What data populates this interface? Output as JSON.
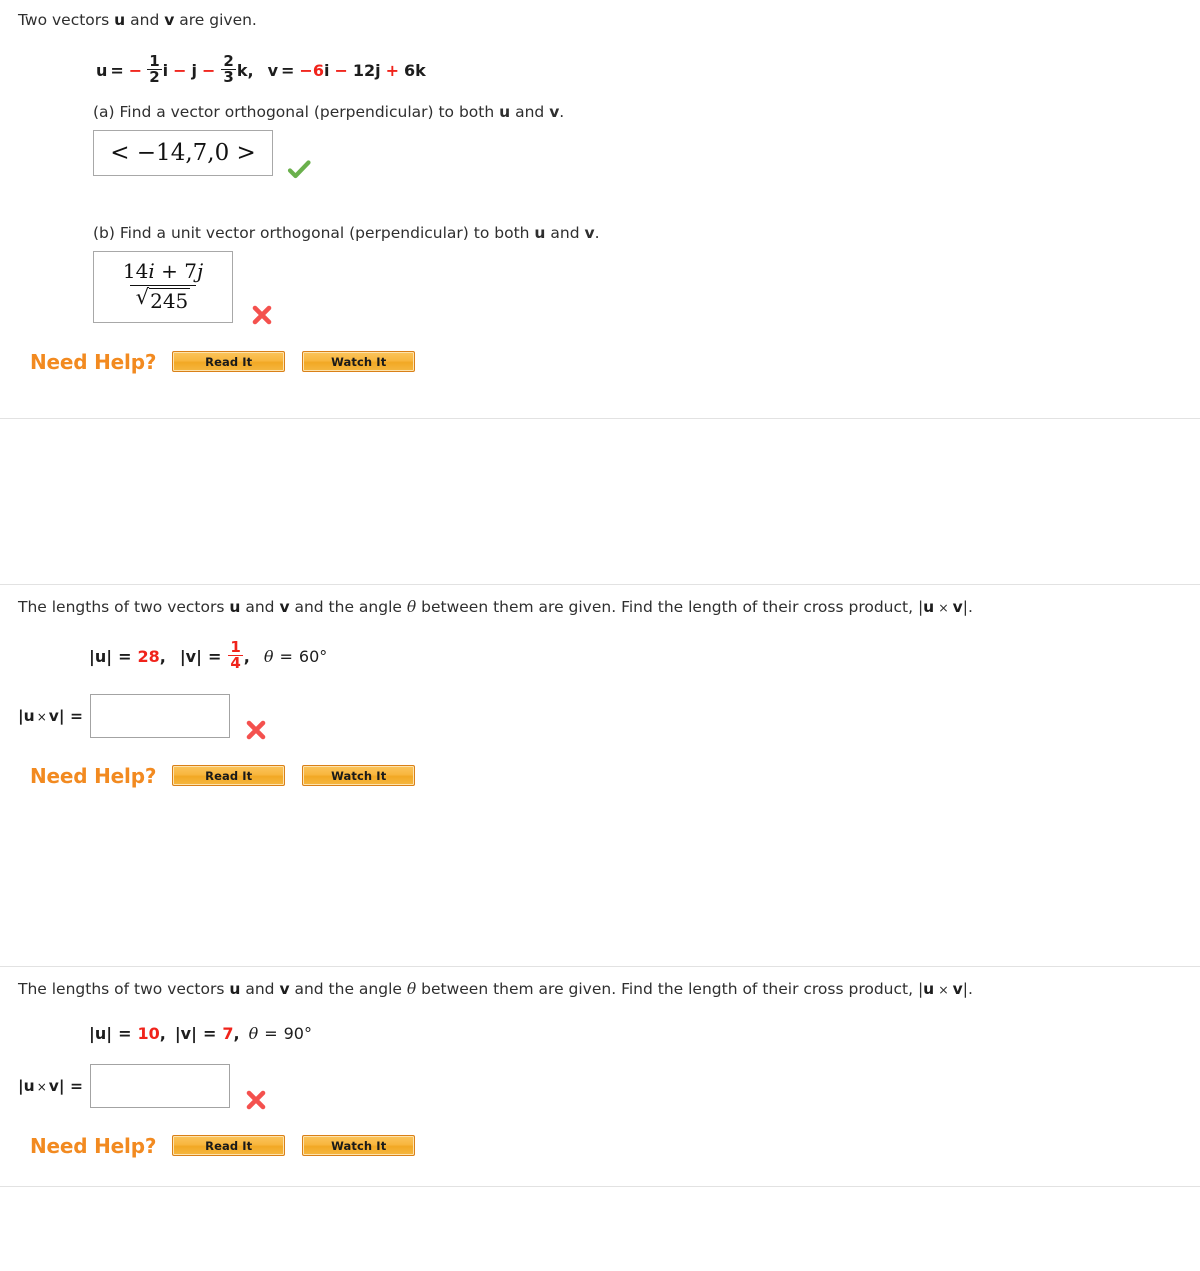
{
  "problems": [
    {
      "prompt_parts": {
        "p1": "Two vectors ",
        "u": "u",
        "p2": " and ",
        "v": "v",
        "p3": " are given."
      },
      "given": {
        "u_label": "u",
        "equals": "=",
        "u_terms": {
          "minus1": "−",
          "frac1_num": "1",
          "frac1_den": "2",
          "i": "i",
          "minus2": "−",
          "j": "j",
          "minus3": "−",
          "frac2_num": "2",
          "frac2_den": "3",
          "k": "k",
          "comma": ","
        },
        "v_label": "v",
        "v_terms": {
          "minus1": "−6",
          "i": "i",
          "minus2": "−",
          "num2": "12",
          "j": "j",
          "plus": "+",
          "num3": "6",
          "k": "k"
        }
      },
      "parts": [
        {
          "label_a": "(a) Find a vector orthogonal (perpendicular) to both ",
          "label_u": "u",
          "label_mid": " and ",
          "label_v": "v",
          "label_end": ".",
          "answer": "< −14,7,0 >",
          "status": "correct"
        },
        {
          "label_a": "(b) Find a unit vector orthogonal (perpendicular) to both ",
          "label_u": "u",
          "label_mid": " and ",
          "label_v": "v",
          "label_end": ".",
          "answer_numerator": "14i + 7j",
          "answer_num_coef1": "14",
          "answer_num_i": "i",
          "answer_num_plus": "+",
          "answer_num_coef2": "7",
          "answer_num_j": "j",
          "answer_radicand": "245",
          "status": "incorrect"
        }
      ],
      "need_help": {
        "label": "Need Help?",
        "read_it": "Read It",
        "watch_it": "Watch It"
      }
    },
    {
      "prompt_parts": {
        "p1": "The lengths of two vectors ",
        "u": "u",
        "p2": " and ",
        "v": "v",
        "p3": " and the angle ",
        "theta": "θ",
        "p4": " between them are given. Find the length of their cross product, |",
        "u2": "u",
        "times": " × ",
        "v2": "v",
        "p5": "|."
      },
      "given": {
        "u_mag_label": "|u|",
        "u_mag_eq": "=",
        "u_mag_value": "28",
        "comma1": ",",
        "v_mag_label": "|v|",
        "v_mag_eq": "=",
        "v_mag_num": "1",
        "v_mag_den": "4",
        "comma2": ",",
        "theta_label": "θ",
        "theta_eq": "=",
        "theta_value": "60°"
      },
      "answer_field": {
        "label_u": "u",
        "label_times": "×",
        "label_v": "v",
        "label_eq": "=",
        "value": "",
        "status": "incorrect"
      },
      "need_help": {
        "label": "Need Help?",
        "read_it": "Read It",
        "watch_it": "Watch It"
      }
    },
    {
      "prompt_parts": {
        "p1": "The lengths of two vectors ",
        "u": "u",
        "p2": " and ",
        "v": "v",
        "p3": " and the angle ",
        "theta": "θ",
        "p4": " between them are given. Find the length of their cross product, |",
        "u2": "u",
        "times": " × ",
        "v2": "v",
        "p5": "|."
      },
      "given": {
        "u_mag_label": "|u|",
        "u_mag_eq": "=",
        "u_mag_value": "10",
        "comma1": ",",
        "v_mag_label": "|v|",
        "v_mag_eq": "=",
        "v_mag_value": "7",
        "comma2": ",",
        "theta_label": "θ",
        "theta_eq": "=",
        "theta_value": "90°"
      },
      "answer_field": {
        "label_u": "u",
        "label_times": "×",
        "label_v": "v",
        "label_eq": "=",
        "value": "",
        "status": "incorrect"
      },
      "need_help": {
        "label": "Need Help?",
        "read_it": "Read It",
        "watch_it": "Watch It"
      }
    }
  ],
  "colors": {
    "red_value": "#f0231b",
    "correct_green": "#6ab04c",
    "incorrect_red": "#f4514e",
    "help_orange": "#f28a20",
    "divider": "#e2e2e2"
  }
}
